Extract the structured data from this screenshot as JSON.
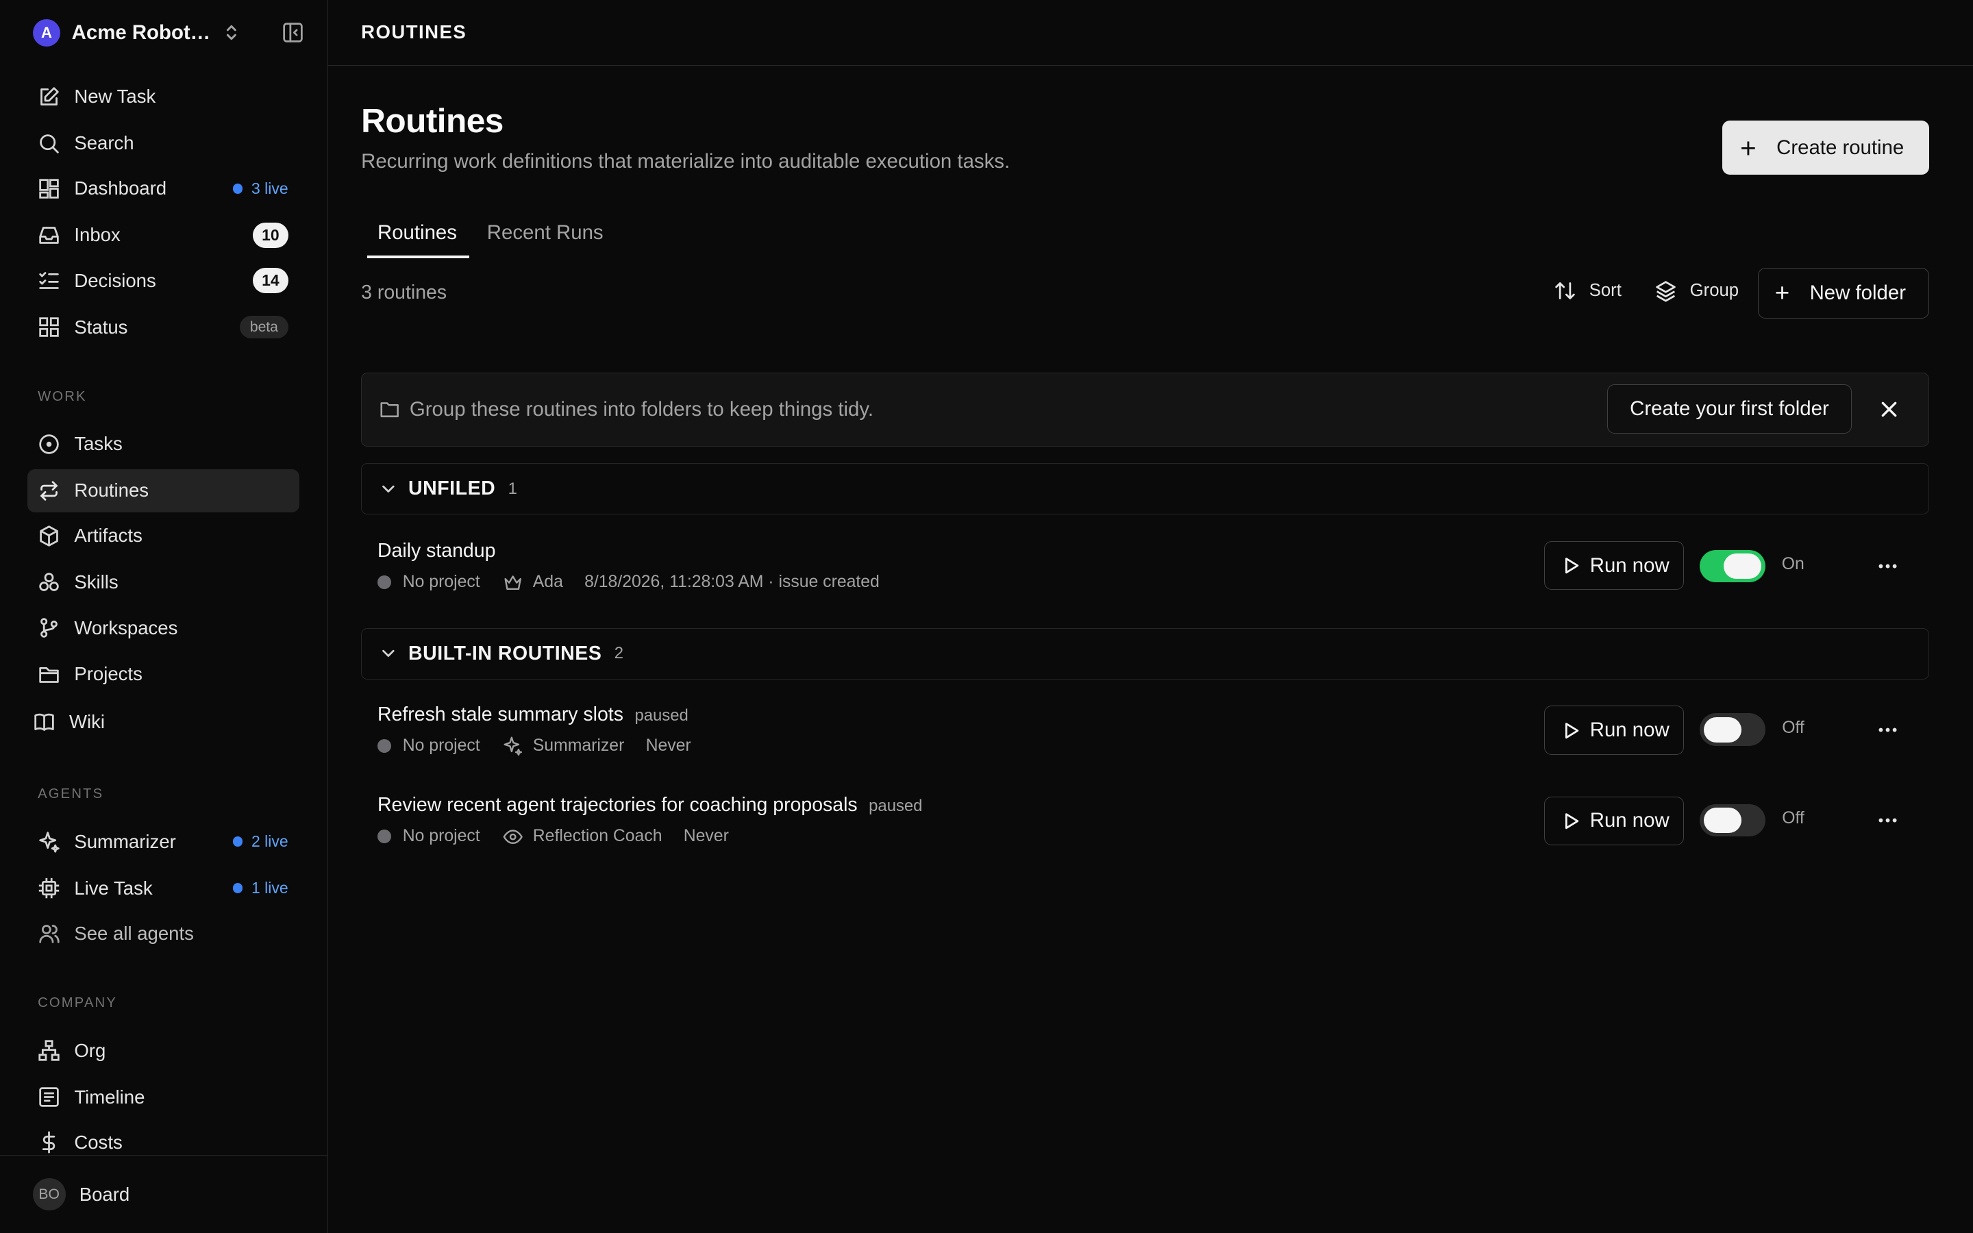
{
  "workspace": {
    "logo_letter": "A",
    "name": "Acme Robotics"
  },
  "sidebar": {
    "primary": [
      {
        "label": "New Task",
        "icon": "edit-icon"
      },
      {
        "label": "Search",
        "icon": "search-icon"
      },
      {
        "label": "Dashboard",
        "icon": "dashboard-icon",
        "live": "3 live"
      },
      {
        "label": "Inbox",
        "icon": "inbox-icon",
        "count": "10"
      },
      {
        "label": "Decisions",
        "icon": "checklist-icon",
        "count": "14"
      },
      {
        "label": "Status",
        "icon": "status-icon",
        "tag": "beta"
      }
    ],
    "work_label": "WORK",
    "work": [
      {
        "label": "Tasks",
        "icon": "circle-dot-icon"
      },
      {
        "label": "Routines",
        "icon": "repeat-icon",
        "active": true
      },
      {
        "label": "Artifacts",
        "icon": "box-icon"
      },
      {
        "label": "Skills",
        "icon": "skills-icon"
      },
      {
        "label": "Workspaces",
        "icon": "branch-icon"
      },
      {
        "label": "Projects",
        "icon": "folder-icon"
      },
      {
        "label": "Wiki",
        "icon": "book-icon"
      }
    ],
    "agents_label": "AGENTS",
    "agents": [
      {
        "label": "Summarizer",
        "icon": "sparkle-icon",
        "live": "2 live"
      },
      {
        "label": "Live Task",
        "icon": "cpu-icon",
        "live": "1 live"
      },
      {
        "label": "See all agents",
        "icon": "users-icon"
      }
    ],
    "company_label": "COMPANY",
    "company": [
      {
        "label": "Org",
        "icon": "org-icon"
      },
      {
        "label": "Timeline",
        "icon": "timeline-icon"
      },
      {
        "label": "Costs",
        "icon": "dollar-icon"
      }
    ],
    "footer": {
      "initials": "BO",
      "label": "Board"
    }
  },
  "header": {
    "breadcrumb": "ROUTINES"
  },
  "page": {
    "title": "Routines",
    "subtitle": "Recurring work definitions that materialize into auditable execution tasks.",
    "create_label": "Create routine",
    "tabs": [
      "Routines",
      "Recent Runs"
    ],
    "count_text": "3 routines",
    "sort_label": "Sort",
    "group_label": "Group",
    "new_folder_label": "New folder",
    "hint_text": "Group these routines into folders to keep things tidy.",
    "hint_button": "Create your first folder"
  },
  "groups": [
    {
      "name": "UNFILED",
      "count": "1",
      "routines": [
        {
          "name": "Daily standup",
          "paused": "",
          "project": "No project",
          "agent": "Ada",
          "agent_icon": "crown-icon",
          "last_run": "8/18/2026, 11:28:03 AM · issue created",
          "run_label": "Run now",
          "enabled": true,
          "state": "On"
        }
      ]
    },
    {
      "name": "BUILT-IN ROUTINES",
      "count": "2",
      "routines": [
        {
          "name": "Refresh stale summary slots",
          "paused": "paused",
          "project": "No project",
          "agent": "Summarizer",
          "agent_icon": "sparkle-icon",
          "last_run": "Never",
          "run_label": "Run now",
          "enabled": false,
          "state": "Off"
        },
        {
          "name": "Review recent agent trajectories for coaching proposals",
          "paused": "paused",
          "project": "No project",
          "agent": "Reflection Coach",
          "agent_icon": "eye-icon",
          "last_run": "Never",
          "run_label": "Run now",
          "enabled": false,
          "state": "Off"
        }
      ]
    }
  ],
  "colors": {
    "accent_live": "#3b82f6",
    "toggle_on": "#22c55e",
    "background": "#0a0a0a"
  }
}
